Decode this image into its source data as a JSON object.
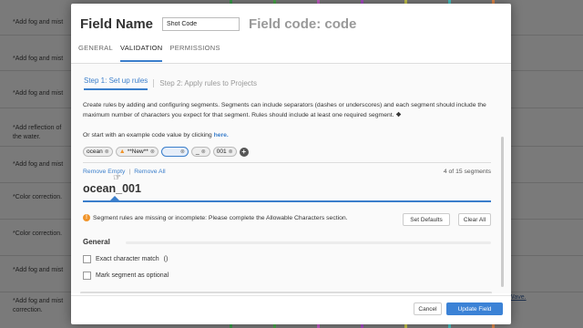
{
  "background": {
    "rows": [
      "*Add fog and mist",
      "*Add fog and mist",
      "*Add fog and mist",
      "*Add reflection of",
      "the water.",
      "*Add fog and mist",
      "*Color correction.",
      "*Color correction.",
      "*Add fog and mist",
      "*Add fog and mist",
      "correction."
    ],
    "right_link": "Wave."
  },
  "dialog": {
    "title": "Field Name",
    "name_value": "Shot Code",
    "field_code": "Field code: code",
    "tabs": [
      "GENERAL",
      "VALIDATION",
      "PERMISSIONS"
    ],
    "active_tab": "VALIDATION",
    "steps": {
      "step1": "Step 1: Set up rules",
      "step2": "Step 2: Apply rules to Projects"
    },
    "description": "Create rules by adding and configuring segments. Segments can include separators (dashes or underscores) and each segment should include the maximum number of characters you expect for that segment. Rules should include at least one required segment.",
    "example_prefix": "Or start with an example code value by clicking",
    "example_link": "here.",
    "chips": {
      "c1": "ocean",
      "c2": "**New**",
      "c3": "",
      "c4": "_",
      "c5": "001"
    },
    "remove_empty": "Remove Empty",
    "remove_all": "Remove All",
    "segment_count": "4 of 15 segments",
    "segment_name": "ocean_001",
    "warning": "Segment rules are missing or incomplete: Please complete the Allowable Characters section.",
    "set_defaults": "Set Defaults",
    "clear_all": "Clear All",
    "general_title": "General",
    "exact_match": "Exact character match",
    "exact_match_suffix": "()",
    "optional": "Mark segment as optional",
    "cancel": "Cancel",
    "update": "Update Field"
  }
}
